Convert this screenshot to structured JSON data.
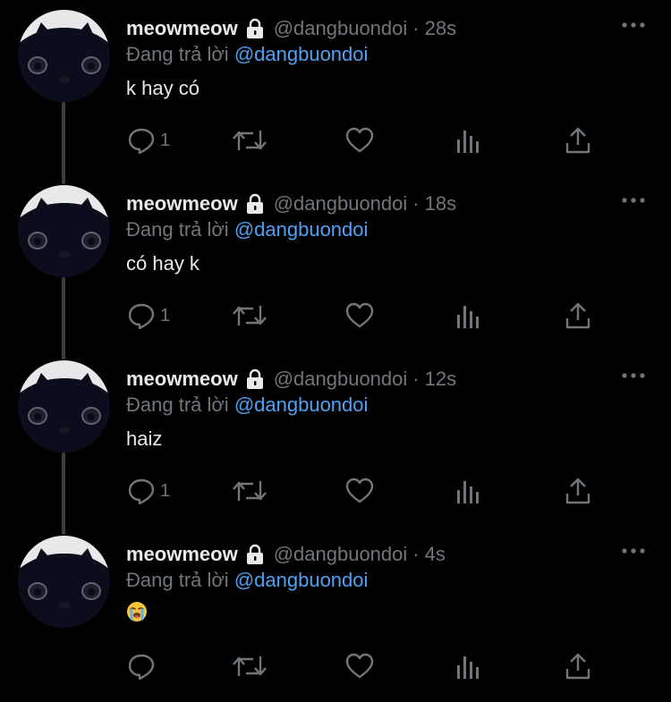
{
  "colors": {
    "background": "#000000",
    "text_primary": "#e7e9ea",
    "text_secondary": "#71767b",
    "link": "#4ea1f3",
    "thread_line": "#3a3d41"
  },
  "tweets": [
    {
      "display_name": "meowmeow",
      "handle": "@dangbuondoi",
      "separator": "·",
      "time": "28s",
      "replying_prefix": "Đang trả lời",
      "replying_to": "@dangbuondoi",
      "text": "k hay có",
      "reply_count": "1",
      "icons": [
        "lock-icon",
        "more-icon",
        "reply-icon",
        "retweet-icon",
        "like-icon",
        "analytics-icon",
        "share-icon"
      ]
    },
    {
      "display_name": "meowmeow",
      "handle": "@dangbuondoi",
      "separator": "·",
      "time": "18s",
      "replying_prefix": "Đang trả lời",
      "replying_to": "@dangbuondoi",
      "text": "có hay k",
      "reply_count": "1"
    },
    {
      "display_name": "meowmeow",
      "handle": "@dangbuondoi",
      "separator": "·",
      "time": "12s",
      "replying_prefix": "Đang trả lời",
      "replying_to": "@dangbuondoi",
      "text": "haiz",
      "reply_count": "1"
    },
    {
      "display_name": "meowmeow",
      "handle": "@dangbuondoi",
      "separator": "·",
      "time": "4s",
      "replying_prefix": "Đang trả lời",
      "replying_to": "@dangbuondoi",
      "emoji": "loudly-crying-face-icon",
      "reply_count": ""
    }
  ]
}
